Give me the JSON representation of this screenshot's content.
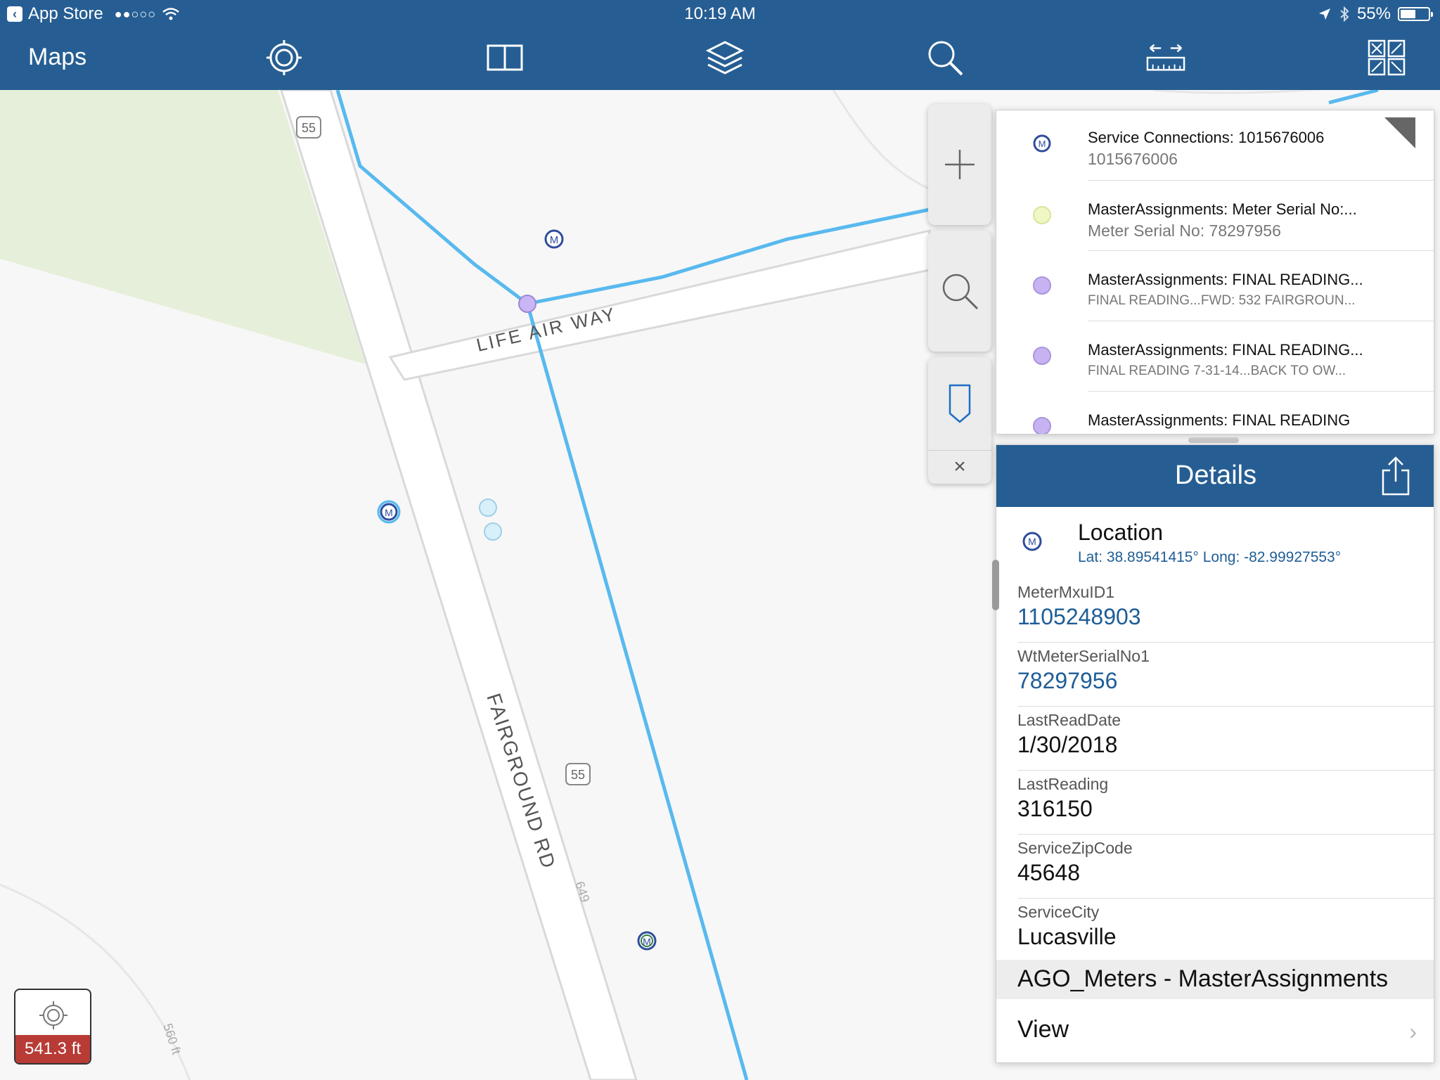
{
  "status_bar": {
    "back_app": "App Store",
    "signal": "●●○○○",
    "time": "10:19 AM",
    "battery": "55%",
    "battery_level": 0.55
  },
  "toolbar": {
    "title": "Maps",
    "icons": [
      "locate-icon",
      "bookmark-book-icon",
      "layers-icon",
      "search-icon",
      "measure-icon",
      "offline-area-icon"
    ]
  },
  "map": {
    "road_labels": {
      "life_air_way": "LIFE AIR WAY",
      "fairground_rd": "FAIRGROUND RD",
      "route_55_top": "55",
      "route_55_bottom": "55",
      "elevation_649": "649",
      "contour_560": "560 ft"
    },
    "controls": {
      "zoom_in": "+",
      "close": "×"
    },
    "colors": {
      "water_line": "#58b9ee",
      "green_area": "#e6efd9",
      "meter_blue": "#2f4d9b",
      "meter_purple": "#c9b6f5",
      "meter_lightblue": "#cfe8f3"
    }
  },
  "results": [
    {
      "title": "Service Connections: 1015676006",
      "subtitle": "1015676006",
      "dot": "meter-icon",
      "color": "#2f4d9b"
    },
    {
      "title": "MasterAssignments: Meter Serial No:...",
      "subtitle": "Meter Serial No: 78297956",
      "dot": "circle",
      "color": "#f0f6c4"
    },
    {
      "title": "MasterAssignments: FINAL READING...",
      "subtitle": "FINAL READING...FWD: 532 FAIRGROUN...",
      "dot": "circle",
      "color": "#c7b3f2"
    },
    {
      "title": "MasterAssignments: FINAL READING...",
      "subtitle": "FINAL READING 7-31-14...BACK TO OW...",
      "dot": "circle",
      "color": "#c7b3f2"
    },
    {
      "title": "MasterAssignments: FINAL READING",
      "subtitle": "",
      "dot": "circle",
      "color": "#c7b3f2"
    }
  ],
  "details": {
    "header": "Details",
    "location": {
      "title": "Location",
      "coords": "Lat: 38.89541415° Long: -82.99927553°"
    },
    "fields": [
      {
        "label": "MeterMxuID1",
        "value": "1105248903",
        "link": true
      },
      {
        "label": "WtMeterSerialNo1",
        "value": "78297956",
        "link": true
      },
      {
        "label": "LastReadDate",
        "value": "1/30/2018",
        "link": false
      },
      {
        "label": "LastReading",
        "value": "316150",
        "link": false
      },
      {
        "label": "ServiceZipCode",
        "value": "45648",
        "link": false
      },
      {
        "label": "ServiceCity",
        "value": "Lucasville",
        "link": false
      }
    ],
    "section_title": "AGO_Meters - MasterAssignments",
    "view_label": "View",
    "view_chevron": "›"
  },
  "scale": {
    "value": "541.3 ft"
  }
}
